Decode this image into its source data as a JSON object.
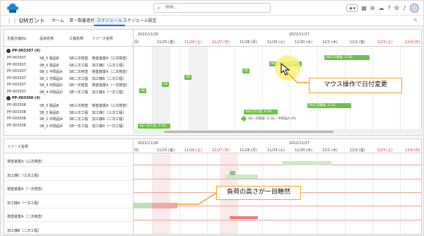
{
  "topbar": {
    "search_placeholder": "検索...",
    "star": "★▾"
  },
  "nav": {
    "app_name": "UMガント",
    "tabs": [
      {
        "label": "ホーム",
        "active": false
      },
      {
        "label": "単一製番進捗",
        "active": false
      },
      {
        "label": "スケジュール",
        "active": true
      },
      {
        "label": "スケジュール設定",
        "active": false
      }
    ]
  },
  "plan": {
    "columns": [
      "生産計画No.",
      "品目名称",
      "工程名称",
      "リソース名称"
    ],
    "date_headers": [
      "2022/11/26",
      "2022/11/27"
    ],
    "days": [
      "4 (月)",
      "11/25 (金)",
      "11/26 (土)",
      "11/27 (日)",
      "11/28 (月)",
      "11/29 (火)",
      "11/30 (水)",
      "12/1 (木)",
      "12/2 (金)",
      "12/3 (土)",
      "12/4 (日)"
    ],
    "groups": [
      {
        "label": "PP-003307 (6)",
        "rows": [
          [
            "PP-003307",
            "SB_0 製品B",
            "SB三次検査",
            "検査装置A（三次検査）"
          ],
          [
            "PP-003307",
            "SB_0 製品B",
            "SB三次工程",
            "加工機C（三次工程）"
          ],
          [
            "PP-003307",
            "SB_1 中間品A",
            "SB二次検査",
            "検査装置A（二次検査）"
          ],
          [
            "PP-003307",
            "SB_1 中間品A",
            "SB二次工程",
            "加工機B（二次工程）"
          ],
          [
            "PP-003307",
            "SB_4 中間品D",
            "SB一次検査",
            "検査装置A（一次検査）"
          ],
          [
            "PP-003307",
            "SB_4 中間品D",
            "SB一次工程",
            "加工機A（一次工程）"
          ]
        ]
      },
      {
        "label": "PP-003308 (4)",
        "rows": [
          [
            "PP-003308",
            "SB_0 製品B",
            "SB三次検査",
            "検査装置A（三次検査）"
          ],
          [
            "PP-003308",
            "SB_0 製品B",
            "SB三次工程",
            "加工機C（三次工程）"
          ],
          [
            "PP-003308",
            "SB_1 中間品A",
            "SB二次工程",
            "加工機B（二次工程）"
          ],
          [
            "PP-003308",
            "SB_1 中間品A",
            "SB一次工程",
            "加工機A（一次工程）"
          ]
        ]
      }
    ],
    "bars": [
      {
        "label": "SB三次検査, 0.58,",
        "row": 0
      },
      {
        "label": "SB三次工程, 0.58,",
        "row": 1
      },
      {
        "label": "SB",
        "row": 2
      },
      {
        "label": "SB",
        "row": 3
      },
      {
        "label": "SB",
        "row": 4
      },
      {
        "label": "SB",
        "row": 5
      },
      {
        "label": "SB三次検査, 0.58,",
        "row": 6
      },
      {
        "label": "SB三次工程, 0.58,",
        "row": 7
      },
      {
        "label": "SB一次工程, 0.58,",
        "row": 9
      }
    ],
    "milestone_label": "SB一次検査, 0.58, ; 中間品A 0%"
  },
  "load": {
    "column": "リソース名称",
    "date_headers": [
      "2022/11/26",
      "2022/11/27"
    ],
    "resources": [
      "検査装置A（三次検査）",
      "加工機C（三次工程）",
      "検査装置A（一次検査）",
      "加工機A（一次工程）",
      "検査装置A（二次検査）",
      "加工機B（二次工程）"
    ]
  },
  "callouts": {
    "drag": "マウス操作で日付変更",
    "load": "負荷の高さが一目瞭然"
  },
  "colors": {
    "accent": "#1b6fc9",
    "bar": "#6cc04a",
    "callout_border": "#f2a31c",
    "highlight": "#fff078",
    "overload": "#e57373"
  }
}
